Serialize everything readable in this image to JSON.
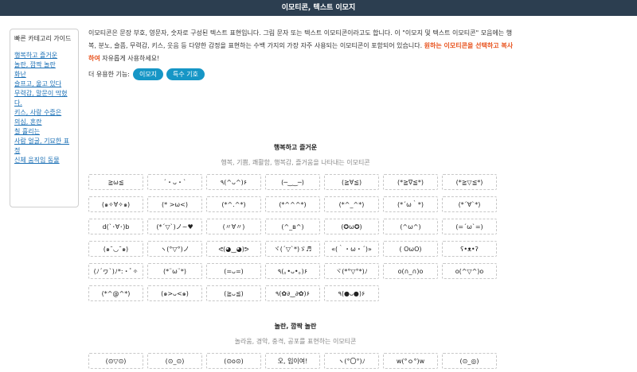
{
  "header": {
    "title": "이모티콘, 텍스트 이모지"
  },
  "sidebar": {
    "title": "빠른 카테고리 가이드",
    "items": [
      {
        "label": "행복하고 즐거운"
      },
      {
        "label": "놀란, 깜짝 놀란"
      },
      {
        "label": "화난"
      },
      {
        "label": "슬프고, 울고 있다"
      },
      {
        "label": "무력감, 말문이 막혔다."
      },
      {
        "label": "키스, 사랑 수줍은"
      },
      {
        "label": "의심, 혼란"
      },
      {
        "label": "칠 흘리는"
      },
      {
        "label": "사람 얼굴, 기묘한 표정"
      },
      {
        "label": "신체 움직임 동물"
      }
    ]
  },
  "intro": {
    "text": "이모티콘은 문장 부호, 영문자, 숫자로 구성된 텍스트 표현입니다. 그림 문자 또는 텍스트 이모티콘이라고도 합니다. 이 \"이모지 및 텍스트 이모티콘\" 모음에는 행복, 분노, 슬픔, 무력감, 키스, 웃음 등 다양한 감정을 표현하는 수백 가지의 가장 자주 사용되는 이모티콘이 포함되어 있습니다. ",
    "highlight": "원하는 이모티콘을 선택하고 복사하여",
    "tail": " 자유롭게 사용하세요!"
  },
  "tools": {
    "label": "더 유용한 기능:",
    "buttons": [
      "이모지",
      "특수 기호"
    ]
  },
  "sections": [
    {
      "title": "행복하고 즐거운",
      "subtitle": "행복, 기쁨, 쾌활함, 행복감, 즐거움을 나타내는 이모티콘",
      "emoticons": [
        "≧ω≦",
        "´・ᴗ・`",
        "٩(^ᴗ^)۶",
        "(─‿‿─)",
        "(≧∀≦)",
        "(*≧∇≦*)",
        "(*≧▽≦*)",
        "(๑✧∀✧๑)",
        "(* >ω<)",
        "(*^.^*)",
        "(*^^^*)",
        "(*^_^*)",
        "(*´ω｀*)",
        "(*´∀`*)",
        "d(`･∀･)b",
        "(*´▽`)ノ~♥",
        "(〃∀〃)",
        "(^_ʙ^)",
        "(✪ω✪)",
        "(^ω^)",
        "(=´ω`=)",
        "(๑¯◡¯๑)",
        "ヽ(°▽°)ノ",
        "ᕙ(◕‿◕)ᕗ",
        "ヾ(´▽`*)ゞ♬",
        "«(｀・ω・´)»",
        "( ՕωՕ)",
        "ʕ•ᴥ•ʔ",
        "(ﾉ´ヮ`)ﾉ*:・ﾟ✧",
        "(*¨ω¨*)",
        "(=ᴗ=)",
        "٩(｡•ᴗ•｡)۶",
        "ヾ(*°▽°*)ﾉ",
        "o(∩_∩)o",
        "o(^▽^)o",
        "(*^@^*)",
        "(๑>ᴗ<๑)",
        "(≧ᴗ≦)",
        "٩(✿∂‿∂✿)۶",
        "٩(●ᴗ●)۶"
      ]
    },
    {
      "title": "놀란, 깜짝 놀란",
      "subtitle": "놀라움, 경악, 충격, 공포를 표현하는 이모티콘",
      "emoticons": [
        "(⊙▽⊙)",
        "(⊙_⊙)",
        "(⊙o⊙)",
        "오, 입이여!",
        "ヽ(°〇°)ﾉ",
        "w(°ｏ°)w",
        "(⊙_◎)"
      ]
    }
  ]
}
